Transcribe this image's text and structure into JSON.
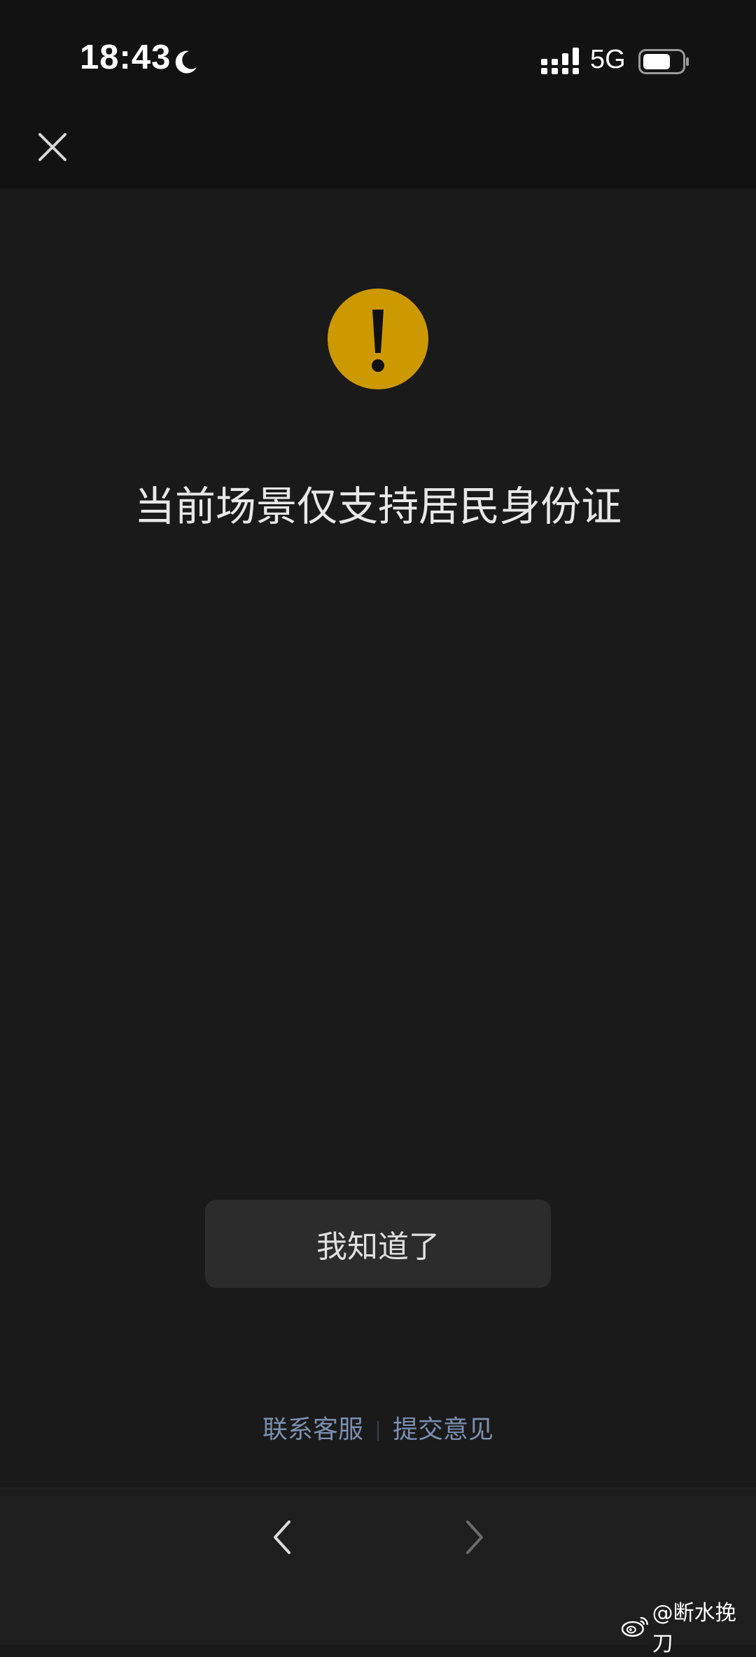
{
  "status_bar": {
    "time": "18:43",
    "network": "5G",
    "icons": [
      "moon-icon",
      "signal-icon",
      "battery-icon"
    ]
  },
  "nav": {
    "close_icon": "close-icon"
  },
  "main": {
    "warning_icon": "warning-icon",
    "warning_color": "#cc9900",
    "message": "当前场景仅支持居民身份证",
    "ack_button_label": "我知道了"
  },
  "footer_links": {
    "contact": "联系客服",
    "feedback": "提交意见",
    "link_color": "#7c8fb0"
  },
  "bottom_nav": {
    "back_icon": "chevron-left-icon",
    "forward_icon": "chevron-right-icon"
  },
  "watermark": {
    "text": "@断水挽刀",
    "logo": "weibo-logo-icon"
  }
}
